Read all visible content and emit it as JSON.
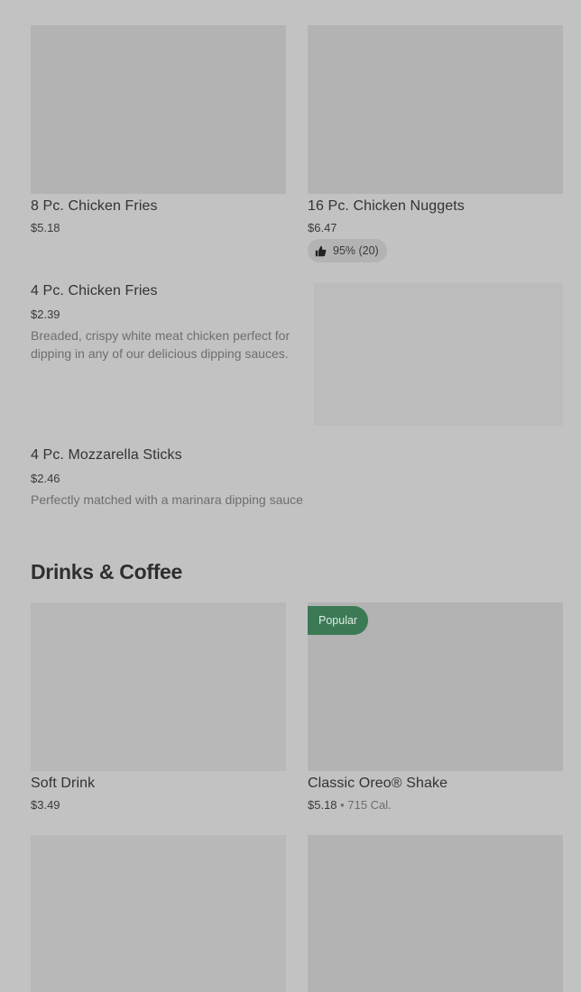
{
  "items_top": [
    {
      "name": "8 Pc. Chicken Fries",
      "price": "$5.18"
    },
    {
      "name": "16 Pc. Chicken Nuggets",
      "price": "$6.47",
      "rating": "95% (20)"
    }
  ],
  "items_list": [
    {
      "name": "4 Pc. Chicken Fries",
      "price": "$2.39",
      "description": "Breaded, crispy white meat chicken perfect for dipping in any of our delicious dipping sauces."
    },
    {
      "name": "4 Pc. Mozzarella Sticks",
      "price": "$2.46",
      "description": "Perfectly matched with a marinara dipping sauce"
    }
  ],
  "section": {
    "title": "Drinks & Coffee"
  },
  "drinks": [
    {
      "name": "Soft Drink",
      "price": "$3.49"
    },
    {
      "name": "Classic Oreo® Shake",
      "price": "$5.18",
      "separator": "•",
      "calories": "715 Cal.",
      "badge": "Popular"
    }
  ],
  "icons": {
    "rating": "thumbs-up-icon"
  },
  "colors": {
    "badge": "#3b7a55",
    "background": "#c2c2c2"
  }
}
